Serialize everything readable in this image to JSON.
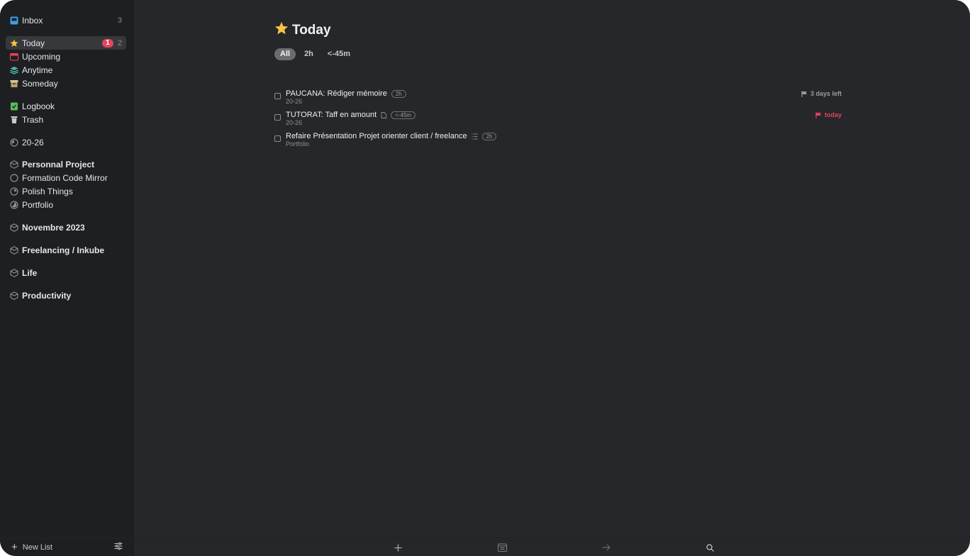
{
  "sidebar": {
    "inbox": {
      "label": "Inbox",
      "count": "3"
    },
    "today": {
      "label": "Today",
      "badge": "1",
      "count": "2"
    },
    "upcoming": {
      "label": "Upcoming"
    },
    "anytime": {
      "label": "Anytime"
    },
    "someday": {
      "label": "Someday"
    },
    "logbook": {
      "label": "Logbook"
    },
    "trash": {
      "label": "Trash"
    },
    "projects": [
      {
        "label": "20-26"
      },
      {
        "label": "Personnal Project"
      },
      {
        "label": "Formation Code Mirror"
      },
      {
        "label": "Polish Things"
      },
      {
        "label": "Portfolio"
      },
      {
        "label": "Novembre 2023"
      },
      {
        "label": "Freelancing / Inkube"
      },
      {
        "label": "Life"
      },
      {
        "label": "Productivity"
      }
    ],
    "new_list": "New List"
  },
  "main": {
    "title": "Today",
    "filters": [
      "All",
      "2h",
      "<-45m"
    ],
    "tasks": [
      {
        "title": "PAUCANA: Rédiger mémoire",
        "tag": "2h",
        "project": "20-26",
        "deadline": "3 days left"
      },
      {
        "title": "TUTORAT: Taff en amount",
        "tag": "<-45m",
        "project": "20-26",
        "deadline": "today"
      },
      {
        "title": "Refaire Présentation Projet orienter client / freelance",
        "tag": "2h",
        "project": "Portfolio"
      }
    ]
  },
  "colors": {
    "accent_red": "#e2445c",
    "star": "#f6c343",
    "inbox": "#3aa0e8",
    "upcoming": "#e2445c",
    "anytime": "#53b7a7",
    "someday": "#d8c490",
    "logbook": "#5bbd5b"
  },
  "icons": {
    "toolbar": [
      "plus-icon",
      "calendar-icon",
      "arrow-right-icon",
      "search-icon"
    ]
  }
}
